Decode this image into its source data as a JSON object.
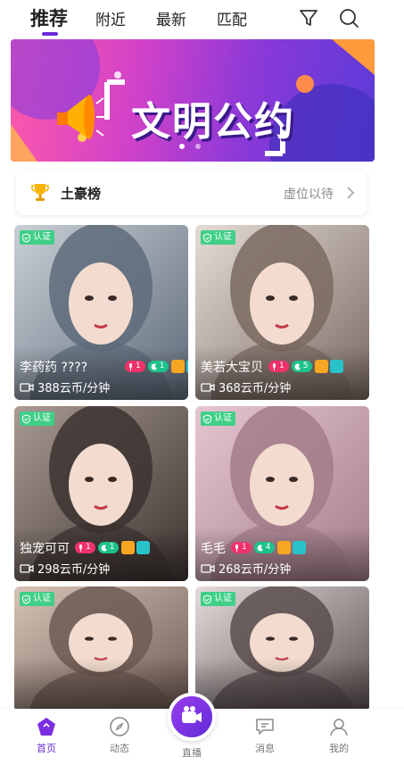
{
  "topnav": {
    "tabs": [
      {
        "label": "推荐",
        "active": true
      },
      {
        "label": "附近",
        "active": false
      },
      {
        "label": "最新",
        "active": false
      },
      {
        "label": "匹配",
        "active": false
      }
    ],
    "icons": [
      "filter-icon",
      "search-icon"
    ]
  },
  "banner": {
    "title": "文明公约",
    "dots": 2
  },
  "rank": {
    "title": "土豪榜",
    "status": "虚位以待",
    "icon": "trophy-icon"
  },
  "cards": [
    {
      "name": "李药药 ????",
      "badge_red": "1",
      "badge_green": "1",
      "price": "388云币/分钟",
      "verified": "认证",
      "tone": [
        "#5e6b7a",
        "#c9cfd6"
      ]
    },
    {
      "name": "美若大宝贝",
      "badge_red": "1",
      "badge_green": "5",
      "price": "368云币/分钟",
      "verified": "认证",
      "tone": [
        "#7a6a62",
        "#e4ddd6"
      ]
    },
    {
      "name": "独宠可可",
      "badge_red": "1",
      "badge_green": "1",
      "price": "298云币/分钟",
      "verified": "认证",
      "tone": [
        "#3c3330",
        "#a99a92"
      ]
    },
    {
      "name": "毛毛",
      "badge_red": "1",
      "badge_green": "4",
      "price": "268云币/分钟",
      "verified": "认证",
      "tone": [
        "#a37d8a",
        "#e6c6d3"
      ]
    },
    {
      "name": "",
      "badge_red": "",
      "badge_green": "",
      "price": "",
      "verified": "认证",
      "tone": [
        "#6d5a52",
        "#d7c3b7"
      ]
    },
    {
      "name": "",
      "badge_red": "",
      "badge_green": "",
      "price": "",
      "verified": "认证",
      "tone": [
        "#5a4e4f",
        "#e6dcdc"
      ]
    }
  ],
  "bottomnav": {
    "items": [
      {
        "label": "首页",
        "active": true
      },
      {
        "label": "动态",
        "active": false
      },
      {
        "label": "直播",
        "active": false
      },
      {
        "label": "消息",
        "active": false
      },
      {
        "label": "我的",
        "active": false
      }
    ]
  },
  "colors": {
    "accent": "#6a2bd8",
    "verify": "#3fcf87",
    "badge_red": "#f0326a",
    "badge_green": "#1ec28b"
  }
}
